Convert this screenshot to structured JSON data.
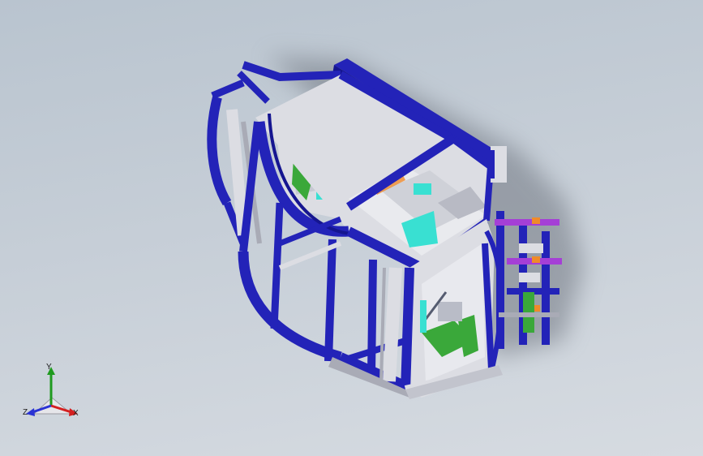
{
  "viewport": {
    "background_top": "#b9c4cf",
    "background_bottom": "#d6dbe1"
  },
  "model": {
    "colors": {
      "frame": "#2323b8",
      "frame_dark": "#151590",
      "panel": "#dcdde3",
      "panel_shadow": "#a9abb6",
      "cyan": "#39e0d2",
      "magenta": "#e033c8",
      "green": "#3aa83a",
      "purple": "#a53fd6",
      "orange": "#ef8a2a",
      "shadow": "#7b8189"
    }
  },
  "triad": {
    "x_label": "X",
    "y_label": "Y",
    "z_label": "Z",
    "x_color": "#d42020",
    "y_color": "#1f9a1f",
    "z_color": "#2a33d4"
  }
}
